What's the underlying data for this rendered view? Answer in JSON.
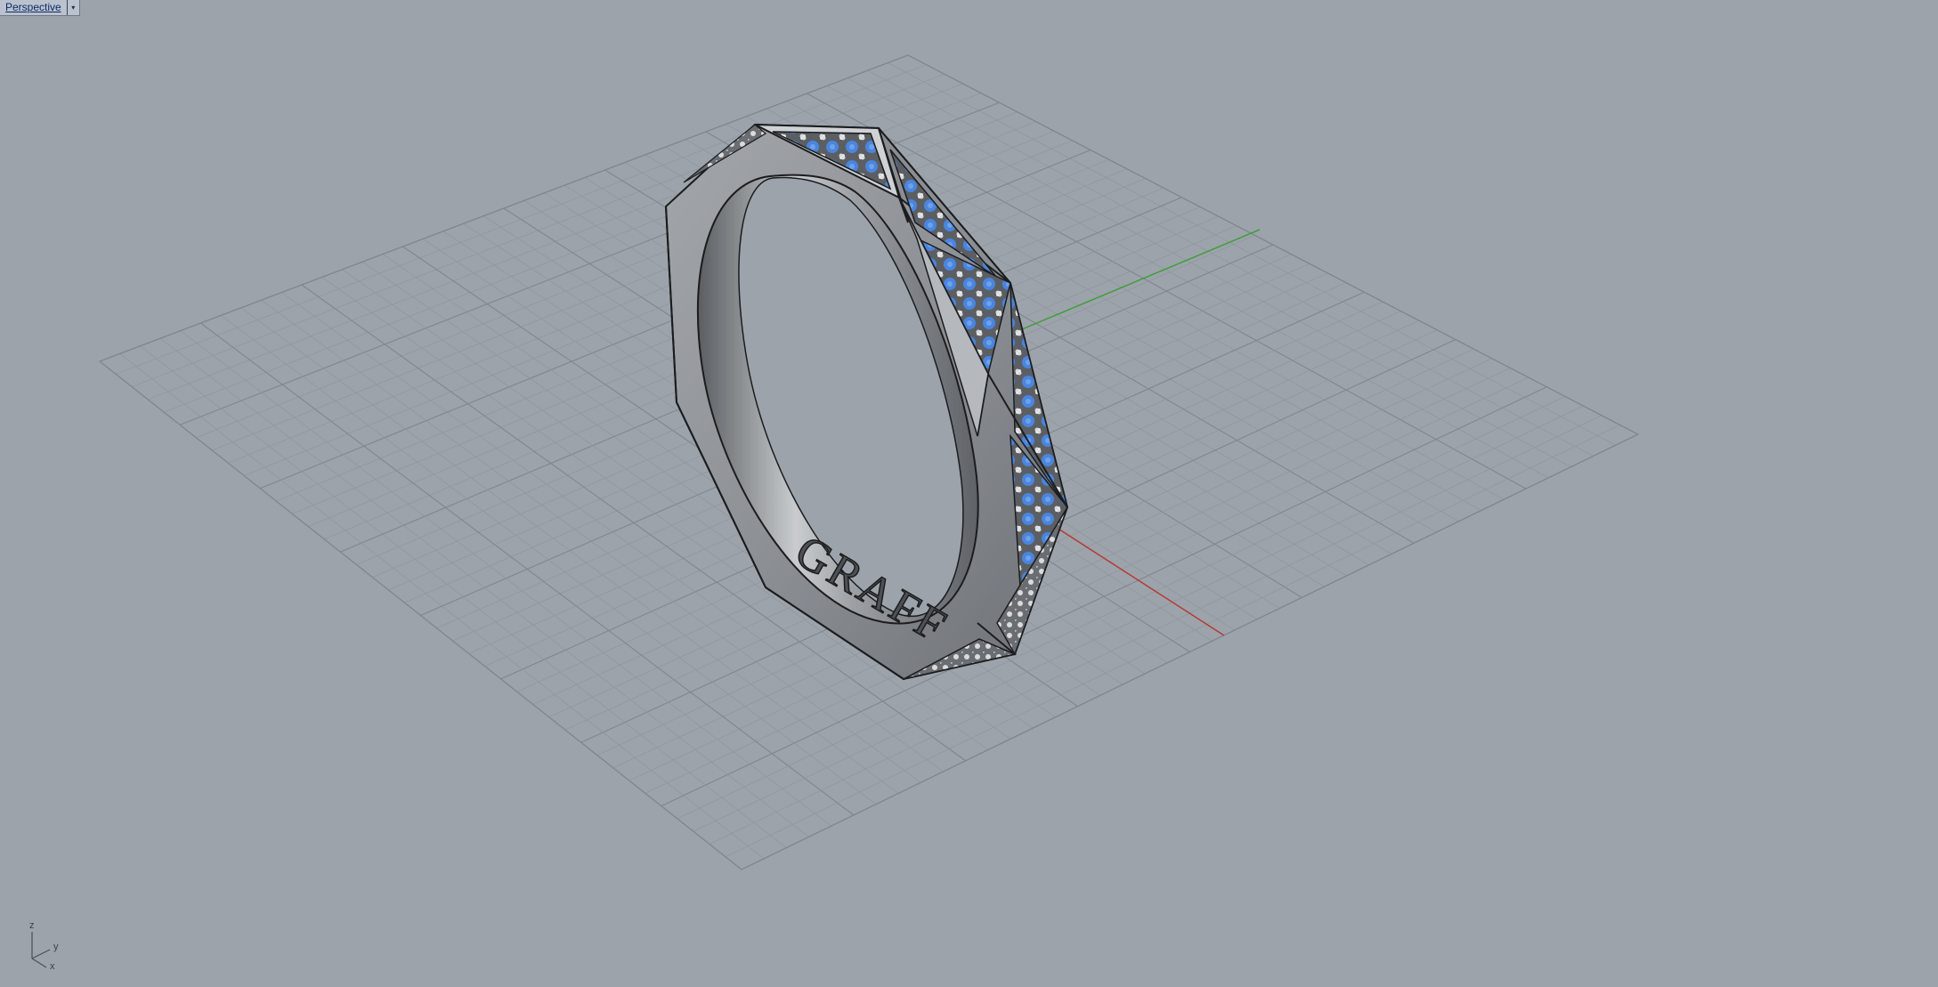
{
  "viewport": {
    "title": "Perspective",
    "dropdown_icon": "dropdown-arrow-icon",
    "background_color": "#9da3aa"
  },
  "scene": {
    "grid_color": "#8a9098",
    "x_axis_color": "#b53a35",
    "y_axis_color": "#3f9e3c",
    "object": "octagonal faceted ring",
    "ring_metal_color": "#8e9297",
    "gem_color": "#4a85de",
    "engraving": "GRAFF"
  },
  "axes_widget": {
    "z_label": "z",
    "y_label": "y",
    "x_label": "x"
  }
}
